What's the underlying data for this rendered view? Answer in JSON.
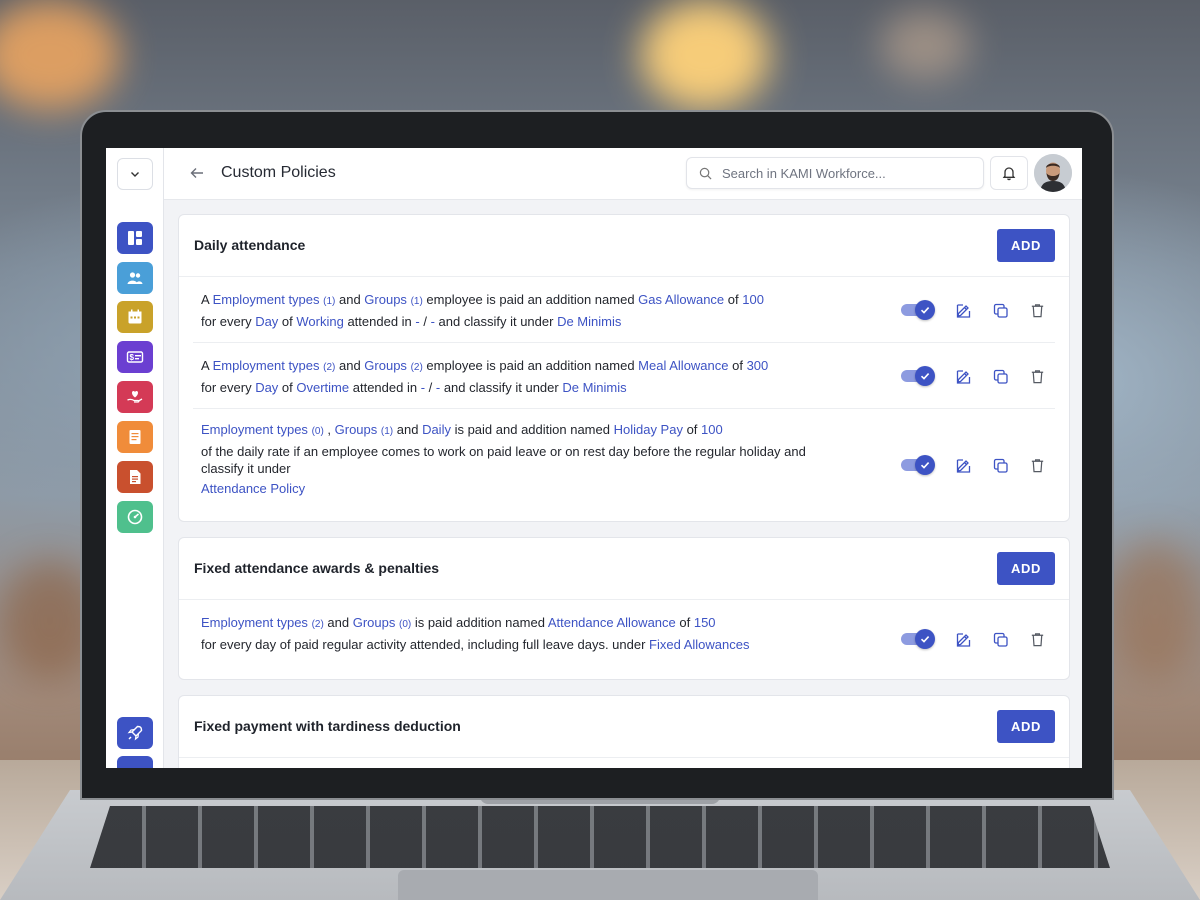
{
  "page": {
    "title": "Custom Policies",
    "search_placeholder": "Search in KAMI Workforce..."
  },
  "sidebar": {
    "items": [
      {
        "name": "dashboard-icon",
        "color": "#3d53c4"
      },
      {
        "name": "people-icon",
        "color": "#4a9fd8"
      },
      {
        "name": "calendar-icon",
        "color": "#c9a22a"
      },
      {
        "name": "payroll-icon",
        "color": "#6b3fd1"
      },
      {
        "name": "benefits-icon",
        "color": "#d43a56"
      },
      {
        "name": "document-icon",
        "color": "#f08c3a"
      },
      {
        "name": "report-icon",
        "color": "#c9502e"
      },
      {
        "name": "gauge-icon",
        "color": "#4fc08d"
      },
      {
        "name": "rocket-icon",
        "color": "#3d53c4"
      }
    ]
  },
  "colors": {
    "accent": "#3d53c4"
  },
  "sections": [
    {
      "title": "Daily attendance",
      "add_label": "ADD",
      "rules": [
        {
          "lines": [
            [
              {
                "t": "A "
              },
              {
                "t": "Employment types",
                "c": "l"
              },
              {
                "t": " "
              },
              {
                "t": "(1)",
                "c": "n"
              },
              {
                "t": " and "
              },
              {
                "t": "Groups",
                "c": "l"
              },
              {
                "t": " "
              },
              {
                "t": "(1)",
                "c": "n"
              },
              {
                "t": " employee is paid an addition named "
              },
              {
                "t": "Gas Allowance",
                "c": "l"
              },
              {
                "t": " of "
              },
              {
                "t": "100",
                "c": "l"
              }
            ],
            [
              {
                "t": "for every "
              },
              {
                "t": "Day",
                "c": "l"
              },
              {
                "t": " of "
              },
              {
                "t": "Working",
                "c": "l"
              },
              {
                "t": " attended in "
              },
              {
                "t": "-",
                "c": "l"
              },
              {
                "t": " / "
              },
              {
                "t": "-",
                "c": "l"
              },
              {
                "t": " and classify it under "
              },
              {
                "t": "De Minimis",
                "c": "l"
              }
            ]
          ],
          "enabled": true
        },
        {
          "lines": [
            [
              {
                "t": "A "
              },
              {
                "t": "Employment types",
                "c": "l"
              },
              {
                "t": " "
              },
              {
                "t": "(2)",
                "c": "n"
              },
              {
                "t": " and "
              },
              {
                "t": "Groups",
                "c": "l"
              },
              {
                "t": " "
              },
              {
                "t": "(2)",
                "c": "n"
              },
              {
                "t": " employee is paid an addition named "
              },
              {
                "t": "Meal Allowance",
                "c": "l"
              },
              {
                "t": " of "
              },
              {
                "t": "300",
                "c": "l"
              }
            ],
            [
              {
                "t": "for every "
              },
              {
                "t": "Day",
                "c": "l"
              },
              {
                "t": " of "
              },
              {
                "t": "Overtime",
                "c": "l"
              },
              {
                "t": " attended in "
              },
              {
                "t": "-",
                "c": "l"
              },
              {
                "t": " / "
              },
              {
                "t": "-",
                "c": "l"
              },
              {
                "t": " and classify it under "
              },
              {
                "t": "De Minimis",
                "c": "l"
              }
            ]
          ],
          "enabled": true
        },
        {
          "lines": [
            [
              {
                "t": "Employment types",
                "c": "l"
              },
              {
                "t": " "
              },
              {
                "t": "(0)",
                "c": "n"
              },
              {
                "t": " , "
              },
              {
                "t": "Groups",
                "c": "l"
              },
              {
                "t": " "
              },
              {
                "t": "(1)",
                "c": "n"
              },
              {
                "t": " and "
              },
              {
                "t": "Daily",
                "c": "l"
              },
              {
                "t": " is paid and addition named "
              },
              {
                "t": "Holiday Pay",
                "c": "l"
              },
              {
                "t": " of "
              },
              {
                "t": "100",
                "c": "l"
              }
            ],
            [
              {
                "t": "of the daily rate if an employee comes to work on paid leave or on rest day before the regular holiday and classify it under"
              }
            ],
            [
              {
                "t": "Attendance Policy",
                "c": "l"
              }
            ]
          ],
          "enabled": true
        }
      ]
    },
    {
      "title": "Fixed attendance awards & penalties",
      "add_label": "ADD",
      "rules": [
        {
          "lines": [
            [
              {
                "t": "Employment types",
                "c": "l"
              },
              {
                "t": " "
              },
              {
                "t": "(2)",
                "c": "n"
              },
              {
                "t": " and "
              },
              {
                "t": "Groups",
                "c": "l"
              },
              {
                "t": " "
              },
              {
                "t": "(0)",
                "c": "n"
              },
              {
                "t": " is paid addition named "
              },
              {
                "t": "Attendance Allowance",
                "c": "l"
              },
              {
                "t": " of "
              },
              {
                "t": "150",
                "c": "l"
              }
            ],
            [
              {
                "t": "for every day of paid regular activity attended, including full leave days. under "
              },
              {
                "t": "Fixed Allowances",
                "c": "l"
              }
            ]
          ],
          "enabled": true
        }
      ]
    },
    {
      "title": "Fixed payment with tardiness deduction",
      "add_label": "ADD",
      "rules": []
    }
  ]
}
